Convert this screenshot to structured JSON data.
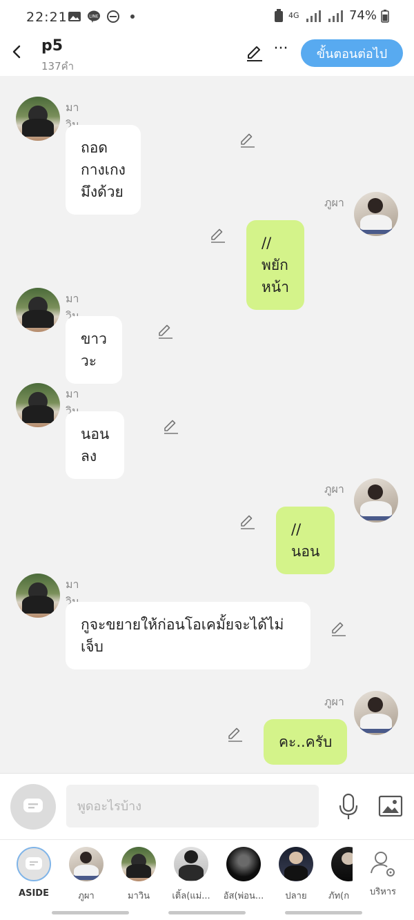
{
  "status_bar": {
    "time": "22:21",
    "network": "4G",
    "battery": "74%"
  },
  "header": {
    "title": "p5",
    "subtitle": "137คำ",
    "next_button": "ขั้นตอนต่อไป"
  },
  "messages": [
    {
      "side": "left",
      "name": "มาวิน",
      "text": "ถอดกางเกงมึงด้วย"
    },
    {
      "side": "right",
      "name": "ภูผา",
      "text": "//พยักหน้า"
    },
    {
      "side": "left",
      "name": "มาวิน",
      "text": "ขาววะ"
    },
    {
      "side": "left",
      "name": "มาวิน",
      "text": "นอนลง"
    },
    {
      "side": "right",
      "name": "ภูผา",
      "text": "//นอน"
    },
    {
      "side": "left",
      "name": "มาวิน",
      "text": "กูจะขยายให้ก่อนโอเคมั้ยจะได้ไม่เจ็บ"
    },
    {
      "side": "right",
      "name": "ภูผา",
      "text": "คะ..ครับ"
    }
  ],
  "composer": {
    "placeholder": "พูดอะไรบ้าง"
  },
  "characters": [
    {
      "label": "ASIDE"
    },
    {
      "label": "ภูผา"
    },
    {
      "label": "มาวิน"
    },
    {
      "label": "เติ้ล(แม่..."
    },
    {
      "label": "อัส(พ่อน..."
    },
    {
      "label": "ปลาย"
    },
    {
      "label": "ภัท(ก"
    },
    {
      "label": "บริหาร"
    }
  ],
  "colors": {
    "accent": "#58aaf0",
    "right_bubble": "#d4f38a",
    "left_bubble": "#ffffff",
    "background": "#f2f2f2"
  },
  "icons": [
    "back-arrow-icon",
    "pencil-icon",
    "more-icon",
    "chat-bubble-icon",
    "microphone-icon",
    "image-icon",
    "person-gear-icon"
  ]
}
